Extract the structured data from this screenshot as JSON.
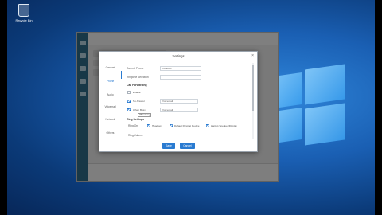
{
  "desktop": {
    "recycle_bin_label": "Recycle Bin"
  },
  "dialog": {
    "title": "Settings",
    "close_glyph": "×",
    "nav": [
      {
        "label": "General"
      },
      {
        "label": "Phone",
        "active": true
      },
      {
        "label": "Audio"
      },
      {
        "label": "Voicemail"
      },
      {
        "label": "Network"
      },
      {
        "label": "Others"
      }
    ],
    "fields": {
      "current_phone_label": "Current Phone",
      "current_phone_value": "Headset",
      "ringtone_label": "Ringtone Selection",
      "ringtone_value": ""
    },
    "call_forwarding": {
      "title": "Call Forwarding",
      "enable_label": "Enable",
      "no_answer_label": "No Answer",
      "no_answer_value": "Voicemail",
      "when_busy_label": "When Busy",
      "when_busy_value": "Voicemail",
      "tooltip": "When Busy"
    },
    "ring_settings": {
      "title": "Ring Settings",
      "ring_on_label": "Ring On",
      "options": [
        "Headset",
        "Default Ringing Device",
        "Laptop Speaker/Display"
      ],
      "ring_volume_label": "Ring Volume"
    },
    "buttons": {
      "save": "Save",
      "cancel": "Cancel"
    },
    "accent_color": "#2a7bd1"
  }
}
